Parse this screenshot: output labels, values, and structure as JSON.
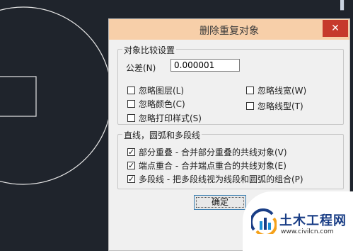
{
  "dialog": {
    "title": "删除重复对象",
    "close_glyph": "✕",
    "compare_group": {
      "title": "对象比较设置",
      "tolerance_label": "公差(N)",
      "tolerance_value": "0.000001",
      "options": [
        {
          "label": "忽略图层(L)",
          "checked": false
        },
        {
          "label": "忽略线宽(W)",
          "checked": false
        },
        {
          "label": "忽略颜色(C)",
          "checked": false
        },
        {
          "label": "忽略线型(T)",
          "checked": false
        },
        {
          "label": "忽略打印样式(S)",
          "checked": false
        }
      ]
    },
    "polyline_group": {
      "title": "直线，圆弧和多段线",
      "options": [
        {
          "label": "部分重叠 - 合并部分重叠的共线对象(V)",
          "checked": true
        },
        {
          "label": "端点重合 - 合并端点重合的共线对象(E)",
          "checked": true
        },
        {
          "label": "多段线 - 把多段线视为线段和圆弧的组合(P)",
          "checked": true
        }
      ]
    },
    "ok_label": "确定"
  },
  "watermark": {
    "name": "土木工程网",
    "url": "www.civilcn.com"
  },
  "colors": {
    "canvas_bg": "#1f242c",
    "titlebar_bg": "#f7cfa9",
    "close_bg": "#c6392c",
    "brand_blue": "#1a3e86"
  }
}
